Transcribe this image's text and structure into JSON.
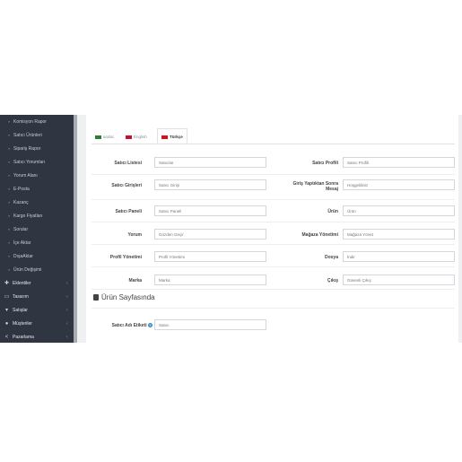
{
  "sidebar": {
    "sub_items": [
      {
        "label": "Komisyon Rapor"
      },
      {
        "label": "Satıcı Ürünleri"
      },
      {
        "label": "Sipariş Rapor"
      },
      {
        "label": "Satıcı Yorumları"
      },
      {
        "label": "Yorum Alanı"
      },
      {
        "label": "E-Posta"
      },
      {
        "label": "Kazanç"
      },
      {
        "label": "Kargo Fiyatları"
      },
      {
        "label": "Sorular"
      },
      {
        "label": "İçe Aktar"
      },
      {
        "label": "DışaAktar"
      },
      {
        "label": "Ürün Değişimi"
      }
    ],
    "main_items": [
      {
        "label": "Eklentiler",
        "icon": "puzzle-icon"
      },
      {
        "label": "Tasarım",
        "icon": "monitor-icon"
      },
      {
        "label": "Satışlar",
        "icon": "cart-icon"
      },
      {
        "label": "Müşteriler",
        "icon": "user-icon"
      },
      {
        "label": "Pazarlama",
        "icon": "share-icon"
      }
    ],
    "bullet": "»",
    "chevron": "‹"
  },
  "tabs": [
    {
      "label": "arabic",
      "active": false,
      "flag_color": "#2f7d32"
    },
    {
      "label": "English",
      "active": false,
      "flag_color": "#c8102e"
    },
    {
      "label": "Türkçe",
      "active": true,
      "flag_color": "#e30a17"
    }
  ],
  "fields": {
    "satici_listesi": {
      "label": "Satıcı Listesi",
      "value": "Satıcılar"
    },
    "satici_profili": {
      "label": "Satıcı Profili",
      "value": "Satıcı Profili"
    },
    "satici_girisleri": {
      "label": "Satıcı Girişleri",
      "value": "Satıcı Girişi"
    },
    "giris_sonra_mesaj": {
      "label_line1": "Giriş Yaptıktan Sonra",
      "label_line2": "Mesaj",
      "value": "Hoşgeldiniz"
    },
    "satici_paneli": {
      "label": "Satıcı Paneli",
      "value": "Satıcı Paneli"
    },
    "urun": {
      "label": "Ürün",
      "value": "Ürün"
    },
    "yorum": {
      "label": "Yorum",
      "value": "Gözden Geçir"
    },
    "magaza_yonetimi": {
      "label": "Mağaza Yönetimi",
      "value": "Mağaza Yönet"
    },
    "profil_yonetimi": {
      "label": "Profil Yönetimi",
      "value": "Profil Yönetimi"
    },
    "dosya": {
      "label": "Dosya",
      "value": "İndir"
    },
    "marka": {
      "label": "Marka",
      "value": "Marka"
    },
    "cikis": {
      "label": "Çıkış",
      "value": "Güvenli Çıkış"
    }
  },
  "section": {
    "title": "Ürün Sayfasında"
  },
  "satici_adi_etiketi": {
    "label": "Satıcı Adı Etiketi",
    "value": "Satıcı",
    "help": "?"
  }
}
